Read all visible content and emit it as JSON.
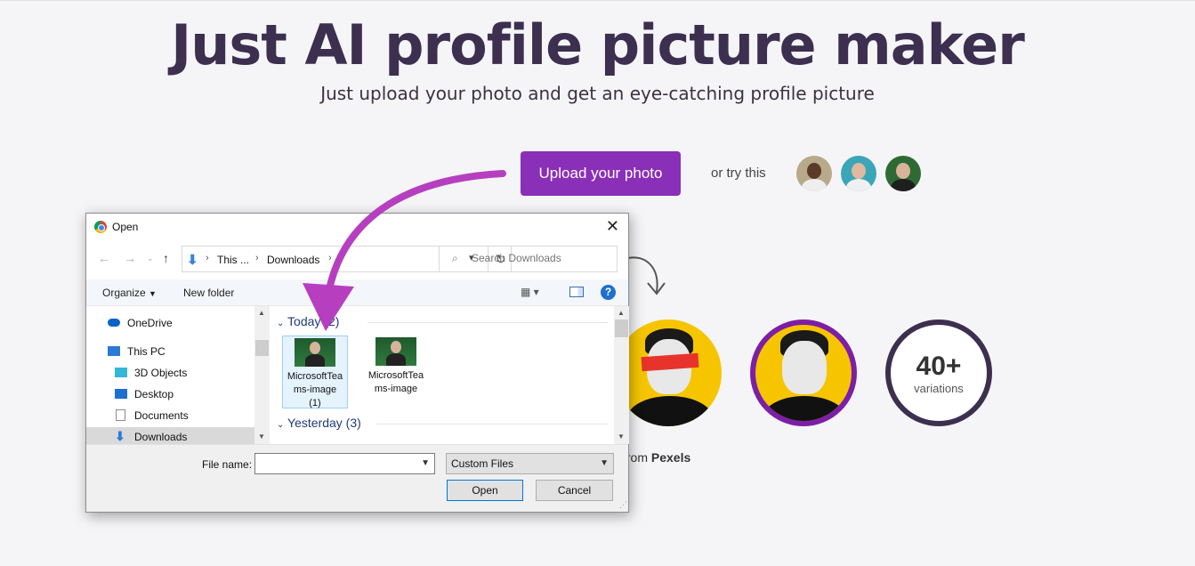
{
  "page": {
    "title": "Just AI profile picture maker",
    "subtitle": "Just upload your photo and get an eye-catching profile picture",
    "upload_label": "Upload your photo",
    "or_try": "or try this",
    "variations_number": "40+",
    "variations_label": "variations",
    "credit_suffix": "from",
    "credit_brand": "Pexels"
  },
  "colors": {
    "brand_purple": "#8a2fb8",
    "heading": "#3d2f4f",
    "yellow": "#f6c500",
    "annotation_arrow": "#b63fc0"
  },
  "dialog": {
    "title": "Open",
    "close_icon": "close-icon",
    "address": [
      "This ...",
      "Downloads"
    ],
    "search_placeholder": "Search Downloads",
    "toolbar": {
      "organize": "Organize",
      "new_folder": "New folder"
    },
    "nav_items": [
      {
        "label": "OneDrive",
        "icon": "onedrive-icon"
      },
      {
        "label": "This PC",
        "icon": "this-pc-icon"
      },
      {
        "label": "3D Objects",
        "icon": "3d-objects-icon"
      },
      {
        "label": "Desktop",
        "icon": "desktop-icon"
      },
      {
        "label": "Documents",
        "icon": "documents-icon"
      },
      {
        "label": "Downloads",
        "icon": "downloads-icon"
      }
    ],
    "groups": [
      {
        "label": "Today (2)"
      },
      {
        "label": "Yesterday (3)"
      }
    ],
    "files": [
      {
        "name": "MicrosoftTeams-image (1)"
      },
      {
        "name": "MicrosoftTeams-image"
      }
    ],
    "file_name_label": "File name:",
    "file_name_value": "",
    "filter": "Custom Files",
    "open_label": "Open",
    "cancel_label": "Cancel"
  }
}
